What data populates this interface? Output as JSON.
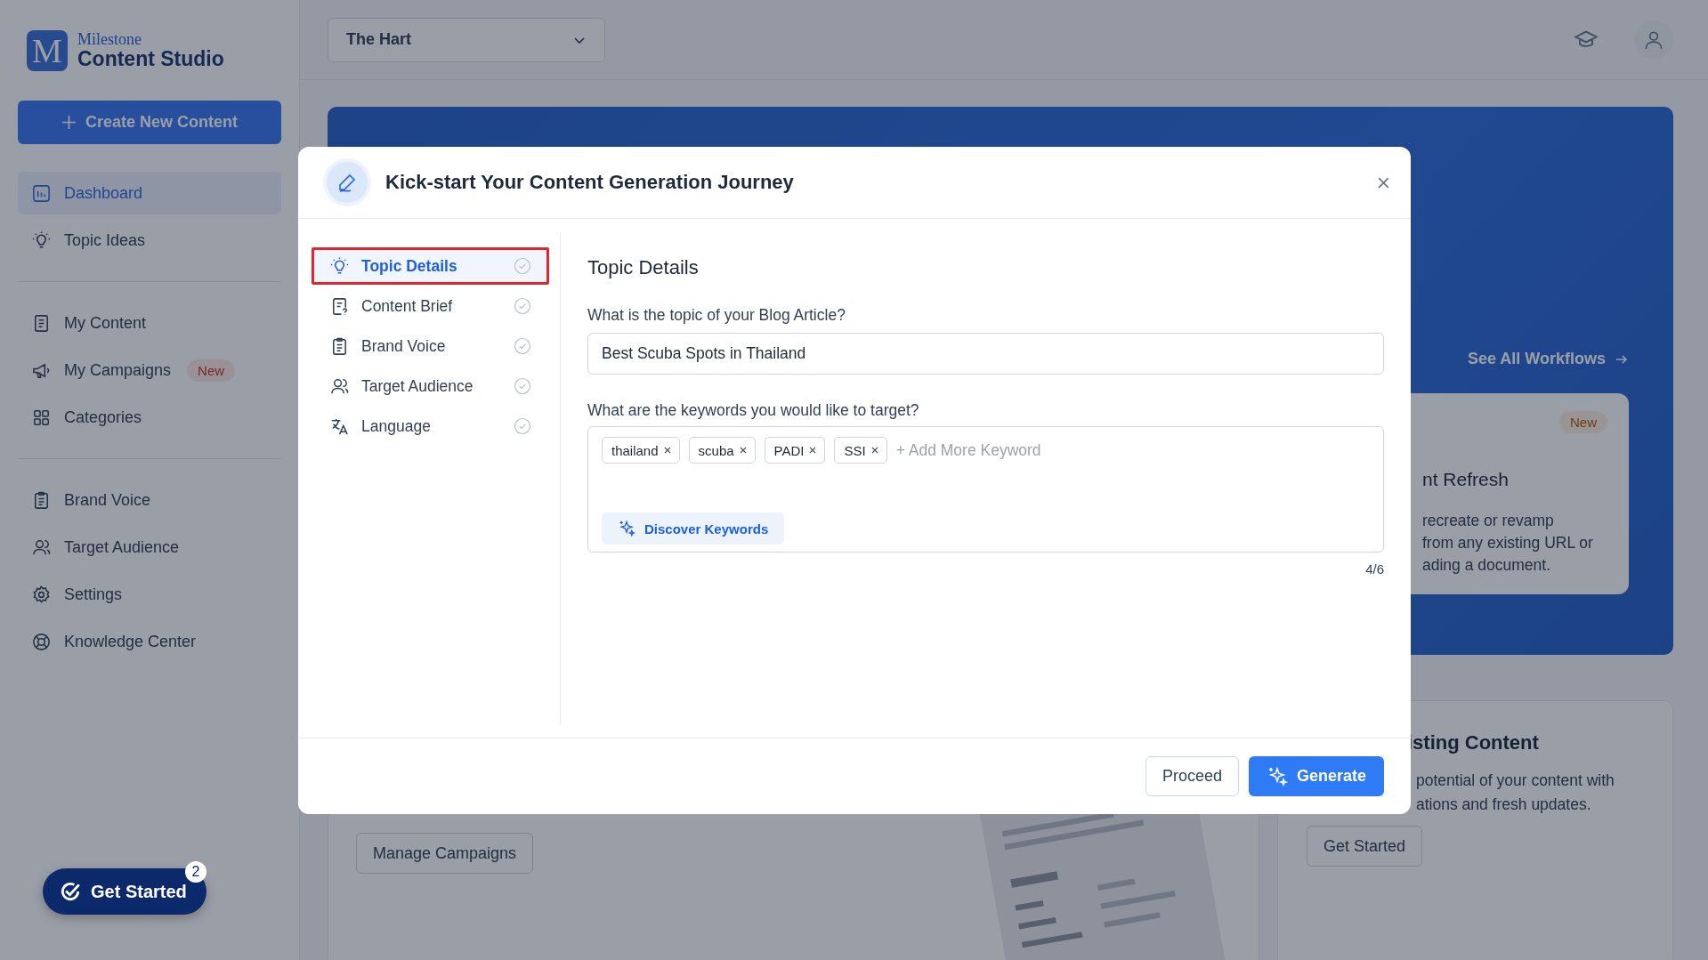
{
  "brand": {
    "logo_letter": "M",
    "over": "Milestone",
    "name": "Content Studio"
  },
  "create_button": "Create New Content",
  "sidebar": {
    "groups": [
      [
        {
          "label": "Dashboard",
          "selected": true
        },
        {
          "label": "Topic Ideas",
          "selected": false
        }
      ],
      [
        {
          "label": "My Content",
          "selected": false
        },
        {
          "label": "My Campaigns",
          "selected": false,
          "badge": "New"
        },
        {
          "label": "Categories",
          "selected": false
        }
      ],
      [
        {
          "label": "Brand Voice",
          "selected": false
        },
        {
          "label": "Target Audience",
          "selected": false
        },
        {
          "label": "Settings",
          "selected": false
        },
        {
          "label": "Knowledge Center",
          "selected": false
        }
      ]
    ]
  },
  "workspace_select": {
    "value": "The Hart"
  },
  "banner": {
    "link": "See All Workflows",
    "card": {
      "badge": "New",
      "title": "nt Refresh",
      "lines": [
        "recreate or revamp",
        "from any existing URL or",
        "ading a document."
      ]
    }
  },
  "campaign_card": {
    "button": "Manage Campaigns",
    "kind": "picture"
  },
  "existing_card": {
    "title": "isting Content",
    "lines": [
      "potential of your content with",
      "ations and fresh updates."
    ],
    "button": "Get Started"
  },
  "modal": {
    "title": "Kick-start Your Content Generation Journey",
    "steps": [
      {
        "label": "Topic Details",
        "selected": true,
        "outlined": true
      },
      {
        "label": "Content Brief",
        "selected": false,
        "outlined": false
      },
      {
        "label": "Brand Voice",
        "selected": false,
        "outlined": false
      },
      {
        "label": "Target Audience",
        "selected": false,
        "outlined": false
      },
      {
        "label": "Language",
        "selected": false,
        "outlined": false
      }
    ],
    "heading": "Topic Details",
    "topic_label": "What is the topic of your Blog Article?",
    "topic_value": "Best Scuba Spots in Thailand",
    "keywords_label": "What are the keywords you would like to target?",
    "keywords": [
      "thailand",
      "scuba",
      "PADI",
      "SSI"
    ],
    "keyword_placeholder": "+ Add More Keyword",
    "discover_button": "Discover Keywords",
    "counter": "4/6",
    "buttons": [
      {
        "label": "Proceed",
        "kind": "secondary"
      },
      {
        "label": "Generate",
        "kind": "primary"
      }
    ]
  },
  "get_started": {
    "label": "Get Started",
    "count": "2"
  }
}
